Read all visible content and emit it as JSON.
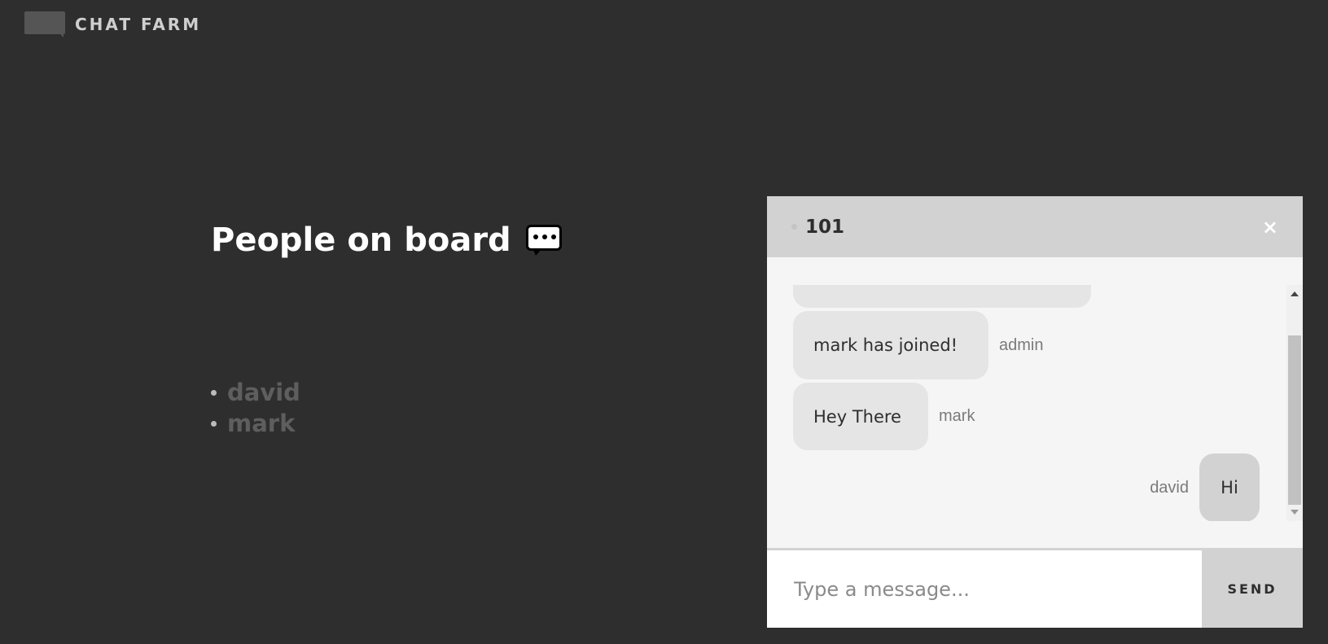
{
  "app": {
    "title": "CHAT FARM"
  },
  "people": {
    "title": "People on board",
    "list": [
      "david",
      "mark"
    ]
  },
  "chat": {
    "room": "101",
    "close_label": "×",
    "messages": [
      {
        "text": "",
        "author": ""
      },
      {
        "text": "mark has joined!",
        "author": "admin"
      },
      {
        "text": "Hey There",
        "author": "mark"
      },
      {
        "text": "Hi",
        "author": "david"
      }
    ],
    "input_placeholder": "Type a message...",
    "send_label": "SEND"
  }
}
